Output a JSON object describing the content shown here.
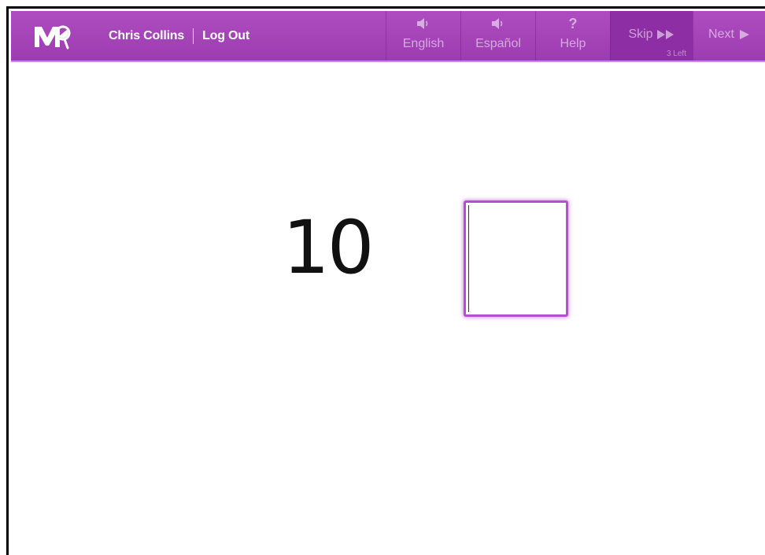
{
  "header": {
    "user_name": "Chris Collins",
    "logout_label": "Log Out",
    "buttons": {
      "english": {
        "label": "English",
        "icon": "speaker-icon"
      },
      "espanol": {
        "label": "Español",
        "icon": "speaker-icon"
      },
      "help": {
        "label": "Help",
        "icon": "question-icon",
        "glyph": "?"
      },
      "skip": {
        "label": "Skip",
        "icon": "double-arrow-right-icon",
        "remaining": "3 Left"
      },
      "next": {
        "label": "Next",
        "icon": "arrow-right-icon"
      }
    }
  },
  "question": {
    "number": "10",
    "answer_value": ""
  },
  "colors": {
    "brand_purple": "#a444b8",
    "accent_border": "#b54fd0"
  }
}
